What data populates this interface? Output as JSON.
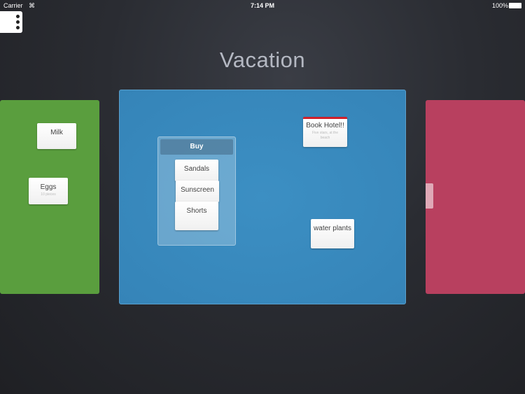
{
  "status_bar": {
    "carrier": "Carrier",
    "time": "7:14 PM",
    "battery": "100%"
  },
  "title": "Vacation",
  "boards": {
    "left": {
      "color": "#5a9e3e",
      "cards": [
        {
          "title": "Milk"
        },
        {
          "title": "Eggs",
          "subtitle": "10 pieces"
        }
      ]
    },
    "center": {
      "color": "#3a8bbf",
      "group": {
        "title": "Buy",
        "cards": [
          "Sandals",
          "Sunscreen",
          "Shorts"
        ]
      },
      "cards": [
        {
          "title": "Book Hotel!!",
          "subtitle": "Five stars, at the beach",
          "accent": "#d0202a"
        },
        {
          "title": "water plants"
        }
      ]
    },
    "right": {
      "color": "#b8405f"
    }
  }
}
